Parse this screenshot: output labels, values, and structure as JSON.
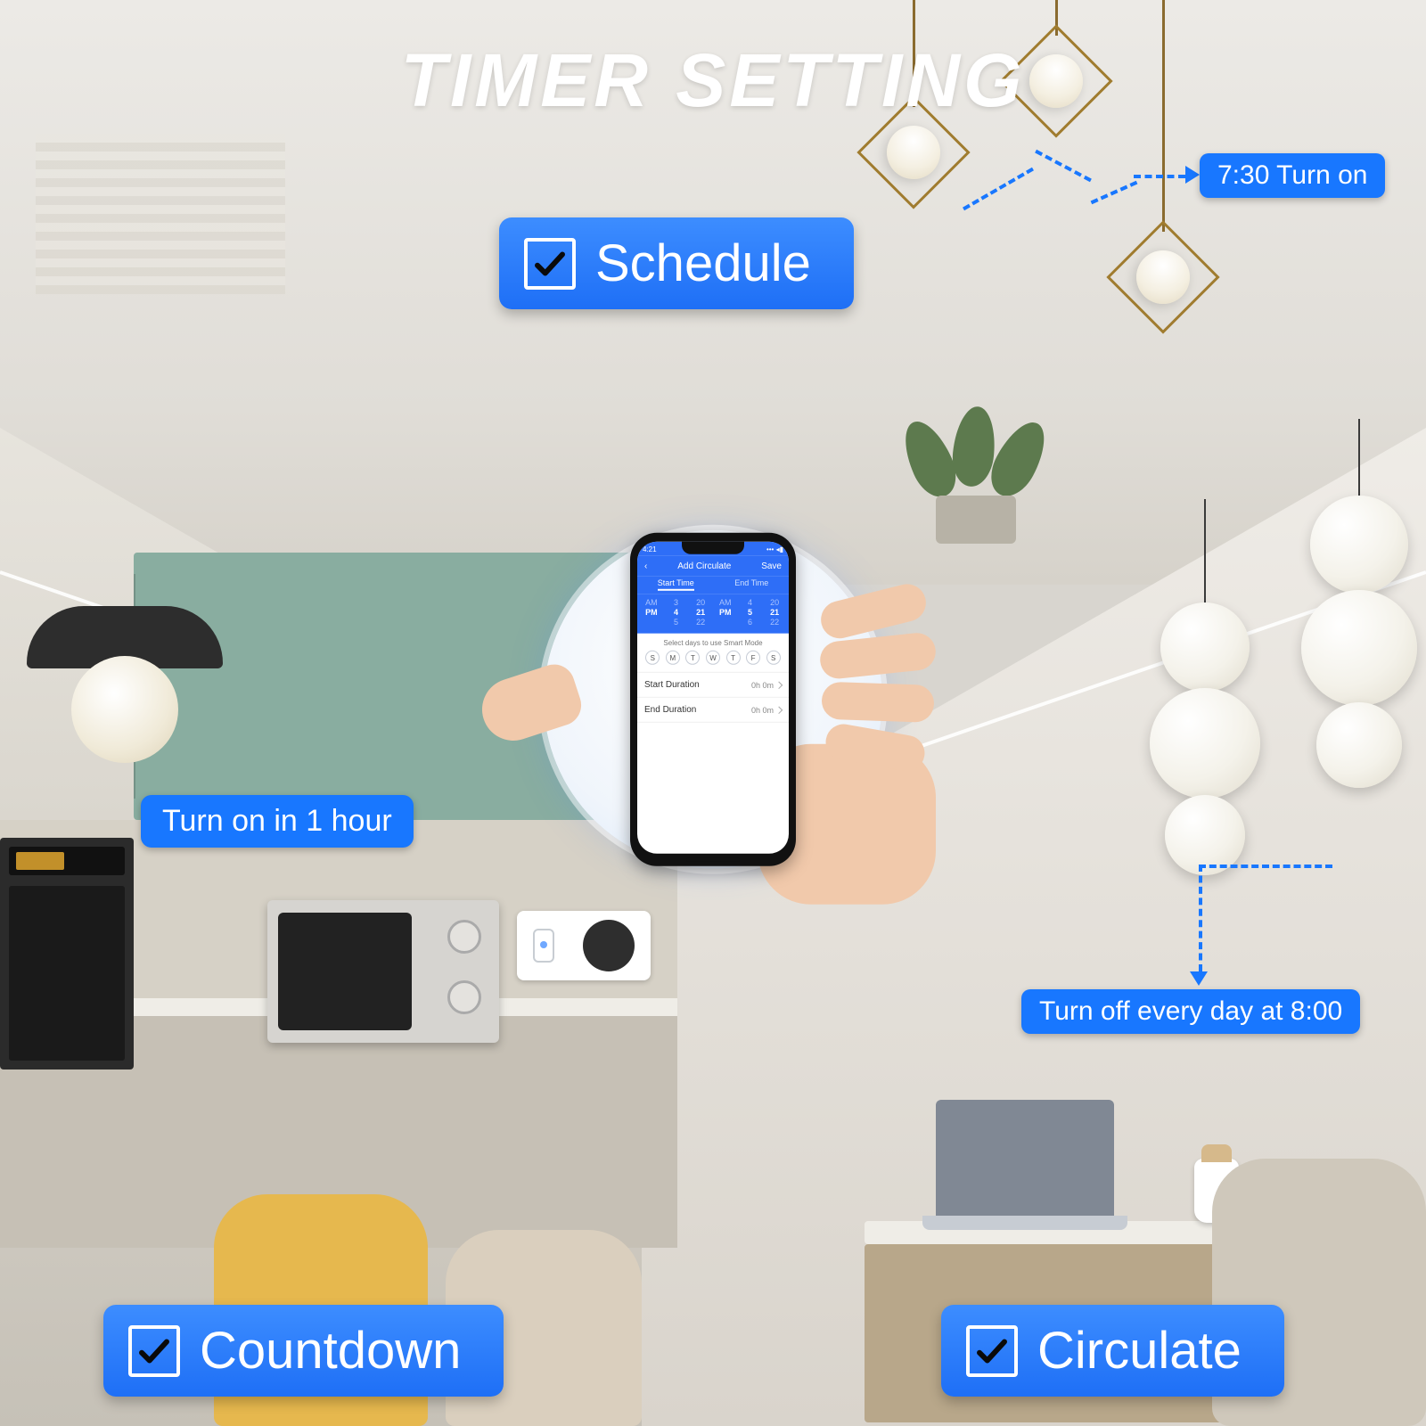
{
  "title": "TIMER SETTING",
  "features": {
    "schedule": {
      "label": "Schedule"
    },
    "countdown": {
      "label": "Countdown"
    },
    "circulate": {
      "label": "Circulate"
    }
  },
  "callouts": {
    "turn_on_730": "7:30 Turn on",
    "turn_on_1h": "Turn on in 1 hour",
    "turn_off_8": "Turn off every day at 8:00"
  },
  "phone": {
    "status_time": "4:21",
    "header_back": "‹",
    "header_title": "Add Circulate",
    "header_save": "Save",
    "tab_start": "Start Time",
    "tab_end": "End Time",
    "picker": {
      "ampm_top": "AM",
      "ampm_mid": "PM",
      "ampm_bot": "",
      "h1_top": "3",
      "h1_mid": "4",
      "h1_bot": "5",
      "m1_top": "20",
      "m1_mid": "21",
      "m1_bot": "22",
      "ampm2_top": "AM",
      "ampm2_mid": "PM",
      "ampm2_bot": "",
      "h2_top": "4",
      "h2_mid": "5",
      "h2_bot": "6",
      "m2_top": "20",
      "m2_mid": "21",
      "m2_bot": "22"
    },
    "days_title": "Select days to use Smart Mode",
    "days": [
      "S",
      "M",
      "T",
      "W",
      "T",
      "F",
      "S"
    ],
    "row_start_label": "Start Duration",
    "row_start_value": "0h 0m",
    "row_end_label": "End Duration",
    "row_end_value": "0h 0m"
  }
}
